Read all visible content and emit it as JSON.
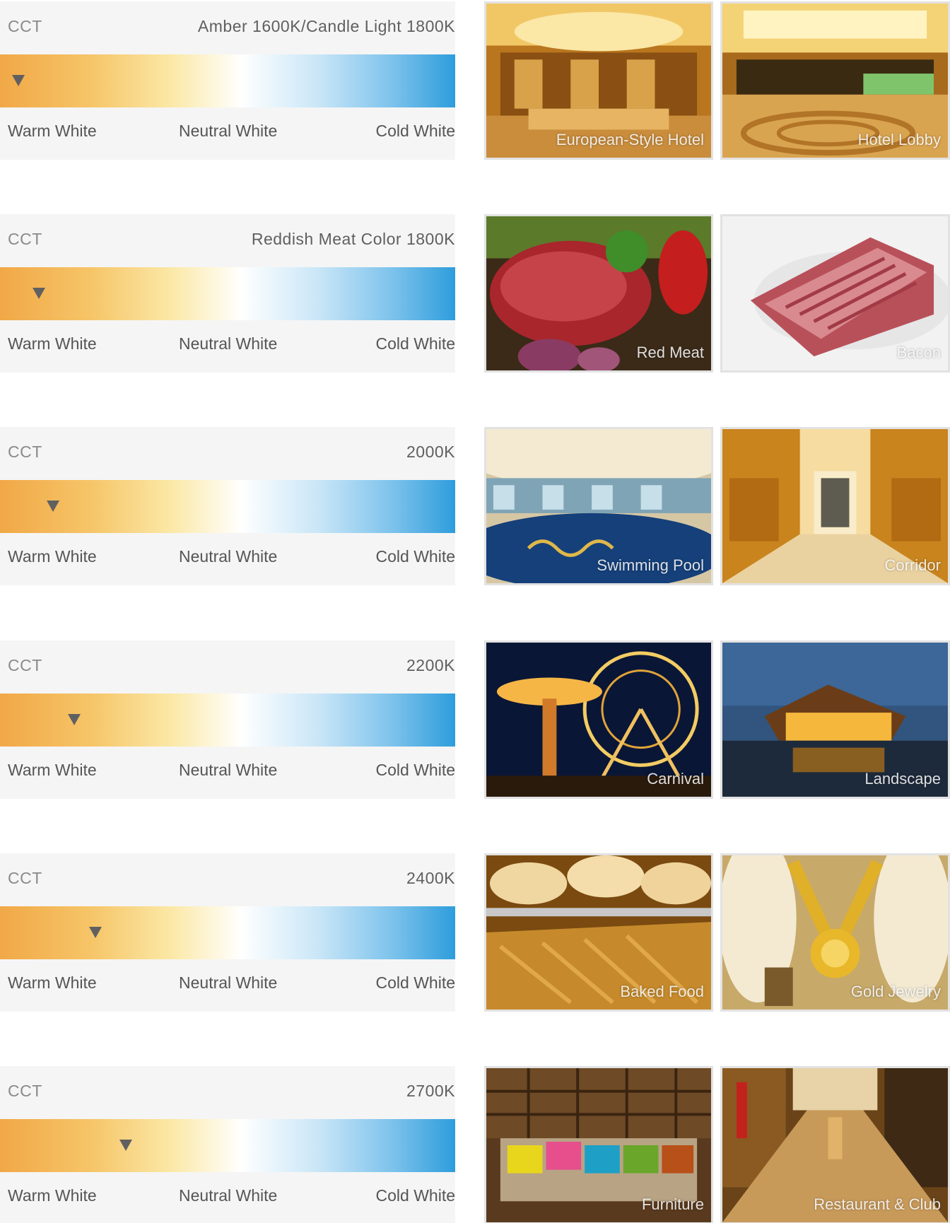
{
  "rows": [
    {
      "cct_label": "CCT",
      "value": "Amber 1600K/Candle Light 1800K",
      "marker": 0.04,
      "warm": "Warm White",
      "neutral": "Neutral White",
      "cold": "Cold White",
      "images": [
        {
          "caption": "European-Style Hotel",
          "scene": "hotel-interior"
        },
        {
          "caption": "Hotel Lobby",
          "scene": "hotel-lobby"
        }
      ]
    },
    {
      "cct_label": "CCT",
      "value": "Reddish Meat Color 1800K",
      "marker": 0.085,
      "warm": "Warm White",
      "neutral": "Neutral White",
      "cold": "Cold White",
      "images": [
        {
          "caption": "Red Meat",
          "scene": "red-meat"
        },
        {
          "caption": "Bacon",
          "scene": "bacon"
        }
      ]
    },
    {
      "cct_label": "CCT",
      "value": "2000K",
      "marker": 0.117,
      "warm": "Warm White",
      "neutral": "Neutral White",
      "cold": "Cold White",
      "images": [
        {
          "caption": "Swimming Pool",
          "scene": "swimming-pool"
        },
        {
          "caption": "Corridor",
          "scene": "corridor"
        }
      ]
    },
    {
      "cct_label": "CCT",
      "value": "2200K",
      "marker": 0.163,
      "warm": "Warm White",
      "neutral": "Neutral White",
      "cold": "Cold White",
      "images": [
        {
          "caption": "Carnival",
          "scene": "carnival"
        },
        {
          "caption": "Landscape",
          "scene": "landscape"
        }
      ]
    },
    {
      "cct_label": "CCT",
      "value": "2400K",
      "marker": 0.209,
      "warm": "Warm White",
      "neutral": "Neutral White",
      "cold": "Cold White",
      "images": [
        {
          "caption": "Baked Food",
          "scene": "baked-food"
        },
        {
          "caption": "Gold Jewelry",
          "scene": "gold-jewelry"
        }
      ]
    },
    {
      "cct_label": "CCT",
      "value": "2700K",
      "marker": 0.276,
      "warm": "Warm White",
      "neutral": "Neutral White",
      "cold": "Cold White",
      "images": [
        {
          "caption": "Furniture",
          "scene": "furniture"
        },
        {
          "caption": "Restaurant & Club",
          "scene": "restaurant-club"
        }
      ]
    }
  ],
  "colors": {
    "panel_bg": "#f5f5f5",
    "gradient": [
      "#f1a847",
      "#f6c568",
      "#fbe9a8",
      "#ffffff",
      "#c9e6f7",
      "#7ec3ec",
      "#2e9ddc"
    ],
    "marker": "#606060"
  }
}
